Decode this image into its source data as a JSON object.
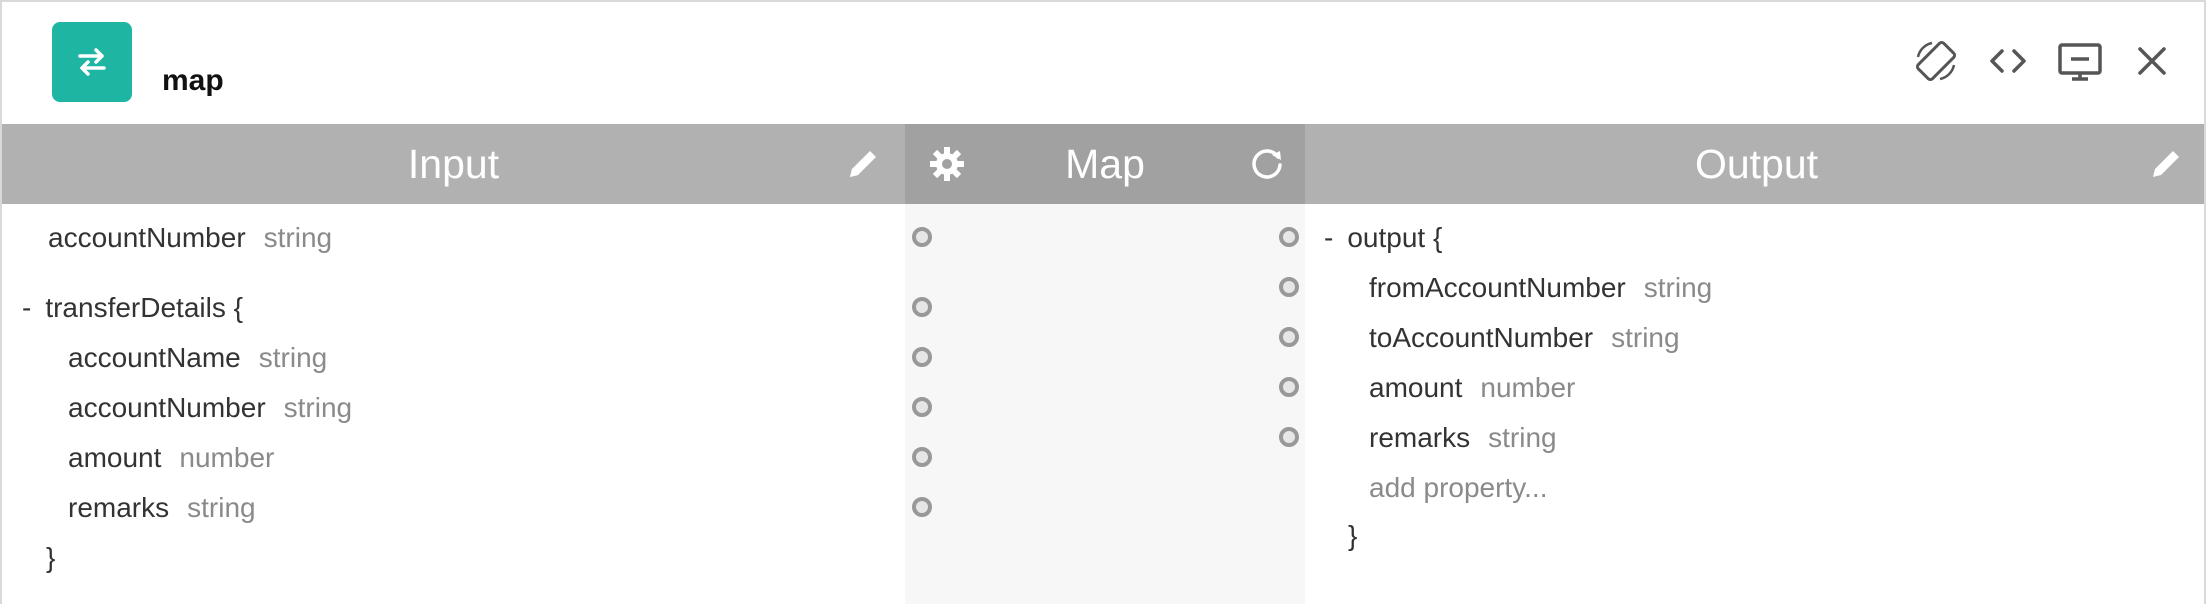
{
  "colors": {
    "accent": "#1fb5a3",
    "header_bar": "#b1b1b1",
    "map_header_bar": "#a1a1a1",
    "type_text": "#8a8a8a"
  },
  "app": {
    "icon": "swap-arrows-icon",
    "title": "map"
  },
  "toolbar": {
    "icons": [
      "rotate-icon",
      "code-icon",
      "monitor-icon",
      "close-icon"
    ]
  },
  "columns": {
    "input": {
      "label": "Input",
      "icon": "pencil-icon"
    },
    "map": {
      "label": "Map",
      "left_icon": "gear-icon",
      "right_icon": "refresh-icon"
    },
    "output": {
      "label": "Output",
      "icon": "pencil-icon"
    }
  },
  "input_schema": {
    "top_field": {
      "name": "accountNumber",
      "type": "string"
    },
    "object": {
      "toggle": "-",
      "name": "transferDetails",
      "open": "{",
      "close": "}",
      "fields": [
        {
          "name": "accountName",
          "type": "string"
        },
        {
          "name": "accountNumber",
          "type": "string"
        },
        {
          "name": "amount",
          "type": "number"
        },
        {
          "name": "remarks",
          "type": "string"
        }
      ]
    }
  },
  "output_schema": {
    "object": {
      "toggle": "-",
      "name": "output",
      "open": "{",
      "close": "}",
      "fields": [
        {
          "name": "fromAccountNumber",
          "type": "string"
        },
        {
          "name": "toAccountNumber",
          "type": "string"
        },
        {
          "name": "amount",
          "type": "number"
        },
        {
          "name": "remarks",
          "type": "string"
        }
      ],
      "add_property": "add property..."
    }
  }
}
